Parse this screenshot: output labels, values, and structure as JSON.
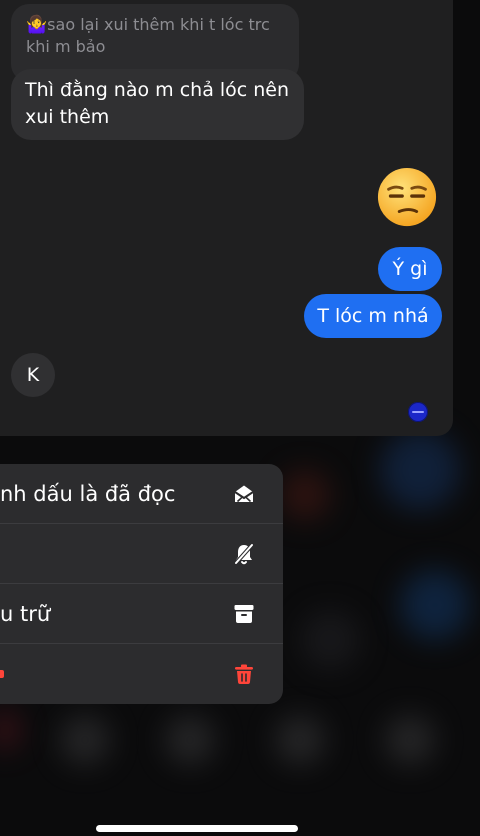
{
  "chat": {
    "reply_quote": {
      "emoji": "🤷‍♀️",
      "text": "sao lại xui thêm khi t lóc trc khi m bảo"
    },
    "messages": {
      "incoming_main": "Thì đằng nào m chả lóc nên xui thêm",
      "outgoing_emoji": "😒",
      "outgoing_1": "Ý gì",
      "outgoing_2": "T lóc m nhá",
      "incoming_k": "K"
    }
  },
  "context_menu": {
    "items": [
      {
        "label": "nh dấu là đã đọc",
        "icon": "mark-read-envelope-icon"
      },
      {
        "label": "",
        "icon": "mute-bell-icon"
      },
      {
        "label": "u trữ",
        "icon": "archive-box-icon"
      },
      {
        "label": "",
        "icon": "trash-icon"
      }
    ]
  },
  "colors": {
    "outgoing_bubble": "#1f6ff2",
    "incoming_bubble": "#303032",
    "menu_background": "#2c2c2e",
    "danger": "#ff453a"
  }
}
